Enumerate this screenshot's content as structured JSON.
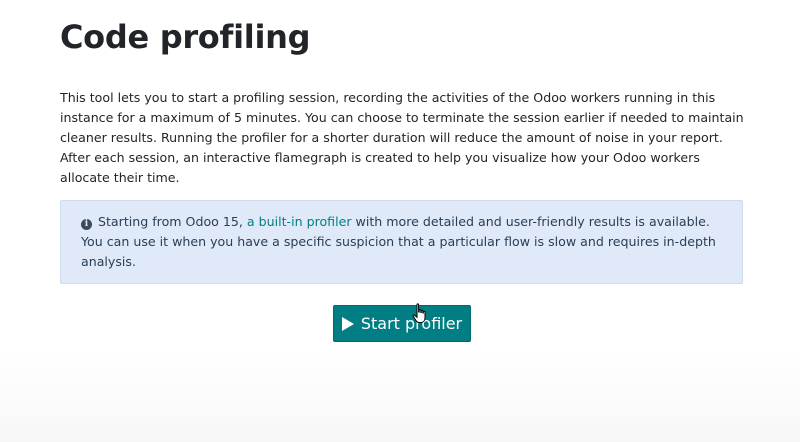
{
  "page": {
    "title": "Code profiling",
    "intro": "This tool lets you to start a profiling session, recording the activities of the Odoo workers running in this instance for a maximum of 5 minutes. You can choose to terminate the session earlier if needed to maintain cleaner results. Running the profiler for a shorter duration will reduce the amount of noise in your report. After each session, an interactive flamegraph is created to help you visualize how your Odoo workers allocate their time."
  },
  "alert": {
    "icon": "info-circle-icon",
    "text_before": " Starting from Odoo 15, ",
    "link_text": "a built-in profiler",
    "text_after": " with more detailed and user-friendly results is available. You can use it when you have a specific suspicion that a particular flow is slow and requires in-depth analysis."
  },
  "button": {
    "icon": "play-icon",
    "label": "Start profiler"
  },
  "colors": {
    "accent": "#017e84",
    "alert_bg": "#e0e9f7",
    "text": "#212529"
  }
}
